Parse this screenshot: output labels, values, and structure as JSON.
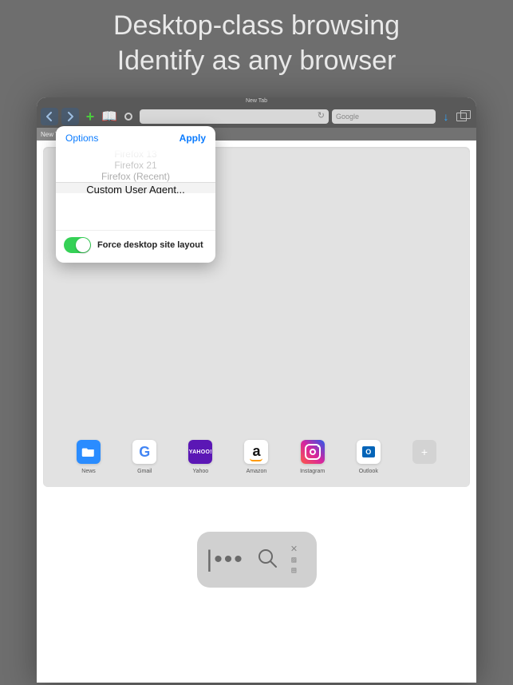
{
  "hero": {
    "line1": "Desktop-class browsing",
    "line2": "Identify as any browser"
  },
  "window": {
    "title": "New Tab",
    "tab_label": "New Tab",
    "search_placeholder": "Google"
  },
  "popover": {
    "options_label": "Options",
    "apply_label": "Apply",
    "picker": {
      "row0": "Firefox 13",
      "row1": "Firefox 21",
      "row2": "Firefox (Recent)",
      "selected": "Custom User Agent..."
    },
    "toggle_label": "Force desktop site layout",
    "toggle_on": true
  },
  "bookmarks": [
    {
      "name": "news",
      "label": "News"
    },
    {
      "name": "gmail",
      "label": "Gmail"
    },
    {
      "name": "yahoo",
      "label": "Yahoo",
      "icon_text": "YAHOO!"
    },
    {
      "name": "amazon",
      "label": "Amazon"
    },
    {
      "name": "instagram",
      "label": "Instagram"
    },
    {
      "name": "outlook",
      "label": "Outlook",
      "icon_text": "O"
    }
  ],
  "dock": {
    "cursor_glyph": "|•••"
  }
}
